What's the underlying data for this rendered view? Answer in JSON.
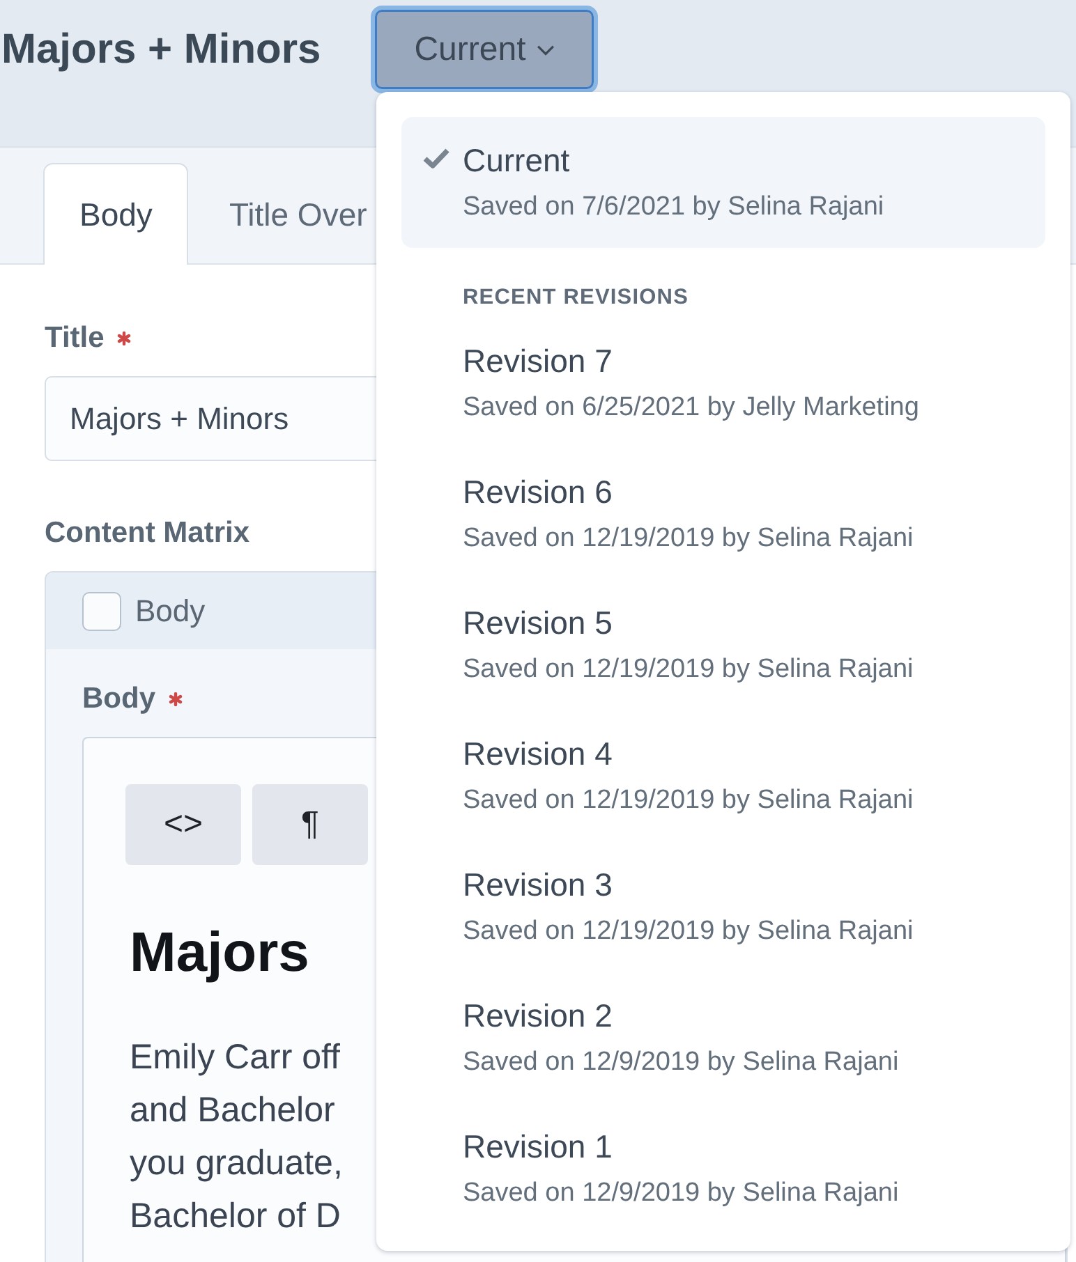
{
  "header": {
    "title": "Majors + Minors",
    "revision_button": {
      "label": "Current",
      "expanded": true,
      "menu": {
        "items": [
          {
            "label": "Current",
            "saved": "Saved on 7/6/2021 by Selina Rajani",
            "selected": true
          }
        ],
        "section_heading": "RECENT REVISIONS",
        "recent_items": [
          {
            "label": "Revision 7",
            "saved": "Saved on 6/25/2021 by Jelly Marketing",
            "selected": false
          },
          {
            "label": "Revision 6",
            "saved": "Saved on 12/19/2019 by Selina Rajani",
            "selected": false
          },
          {
            "label": "Revision 5",
            "saved": "Saved on 12/19/2019 by Selina Rajani",
            "selected": false
          },
          {
            "label": "Revision 4",
            "saved": "Saved on 12/19/2019 by Selina Rajani",
            "selected": false
          },
          {
            "label": "Revision 3",
            "saved": "Saved on 12/19/2019 by Selina Rajani",
            "selected": false
          },
          {
            "label": "Revision 2",
            "saved": "Saved on 12/9/2019 by Selina Rajani",
            "selected": false
          },
          {
            "label": "Revision 1",
            "saved": "Saved on 12/9/2019 by Selina Rajani",
            "selected": false
          }
        ]
      }
    }
  },
  "tabs": [
    {
      "label": "Body",
      "selected": true
    },
    {
      "label": "Title Over",
      "selected": false
    }
  ],
  "title_field": {
    "label": "Title",
    "required": true,
    "value": "Majors + Minors"
  },
  "content_matrix": {
    "label": "Content Matrix",
    "block": {
      "title": "Body",
      "checked": false,
      "field": {
        "label": "Body",
        "required": true,
        "toolbar": [
          "<>",
          "¶"
        ],
        "heading": "Majors",
        "paragraph_lines": [
          "Emily Carr off",
          "and Bachelor",
          "you graduate,",
          "Bachelor of D"
        ]
      }
    }
  }
}
